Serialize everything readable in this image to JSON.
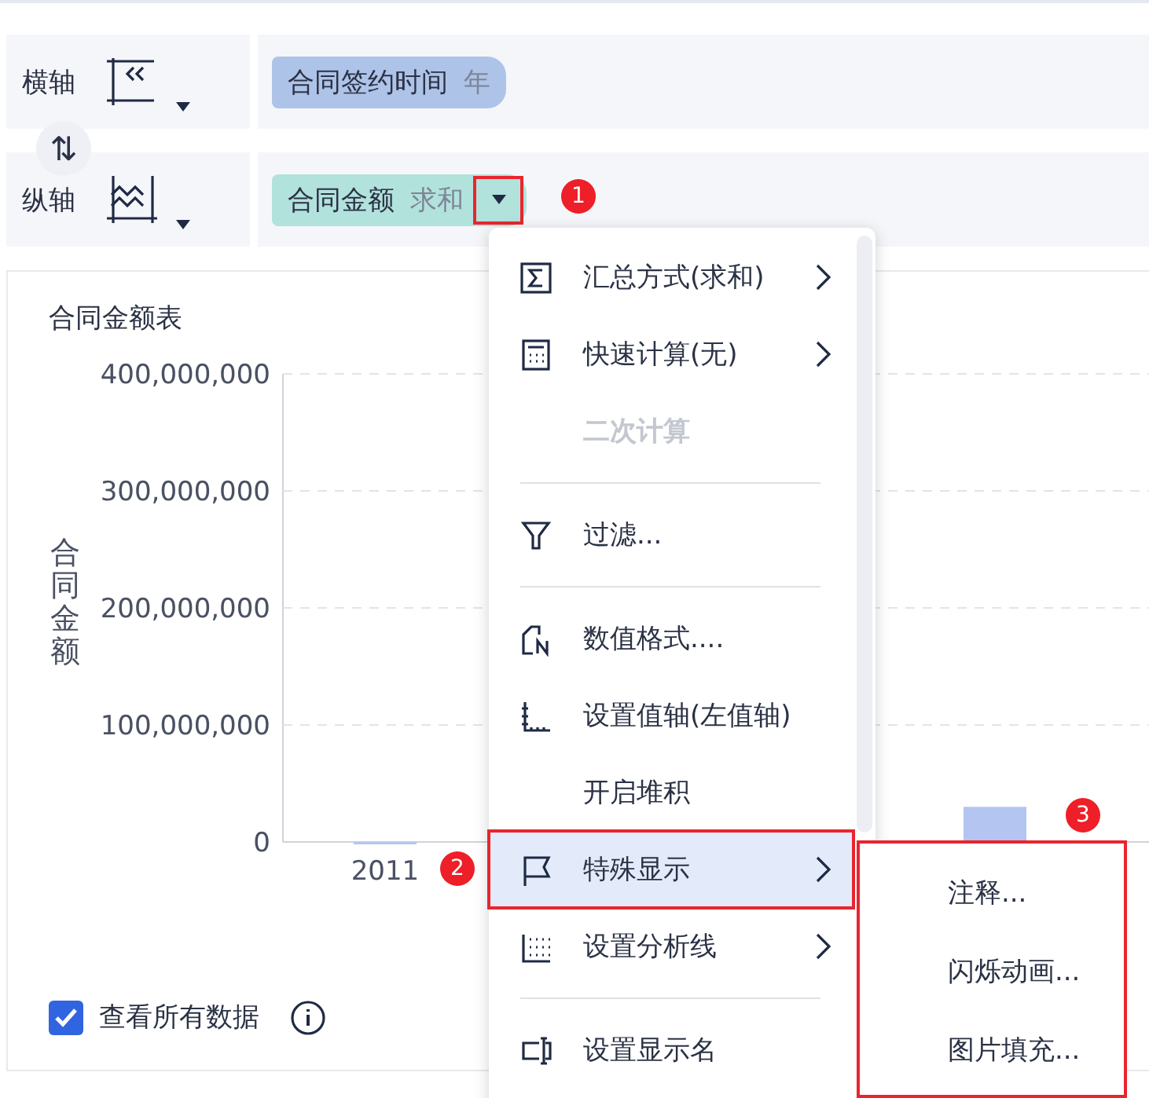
{
  "axes": [
    {
      "label": "横轴",
      "field": {
        "name": "合同签约时间",
        "aggregation": "年",
        "color": "#aec3e8",
        "dropdown_highlighted": false
      }
    },
    {
      "label": "纵轴",
      "field": {
        "name": "合同金额",
        "aggregation": "求和",
        "color": "#b2e2dc",
        "dropdown_highlighted": true
      }
    }
  ],
  "swap": {
    "symbol": "⇅"
  },
  "chart": {
    "title": "合同金额表",
    "y_title": "合同金额",
    "chart_data": {
      "type": "bar",
      "grid": true,
      "categories": [
        "2011",
        null
      ],
      "series": [
        {
          "color": "#b3c5f0",
          "values": [
            0,
            30000000
          ]
        }
      ],
      "ylim": [
        0,
        400000000
      ],
      "yticks": [
        {
          "value": 0,
          "label": "0"
        },
        {
          "value": 100000000,
          "label": "100,000,000"
        },
        {
          "value": 200000000,
          "label": "200,000,000"
        },
        {
          "value": 300000000,
          "label": "300,000,000"
        },
        {
          "value": 400000000,
          "label": "400,000,000"
        }
      ]
    }
  },
  "show_all": {
    "label": "查看所有数据",
    "checked": true
  },
  "menu": {
    "items": [
      {
        "kind": "sigma",
        "label": "汇总方式(求和)",
        "submenu": true,
        "disabled": false,
        "selected": false
      },
      {
        "kind": "calculator",
        "label": "快速计算(无)",
        "submenu": true,
        "disabled": false,
        "selected": false
      },
      {
        "kind": "plain",
        "label": "二次计算",
        "submenu": false,
        "disabled": true,
        "selected": false
      },
      {
        "kind": "divider"
      },
      {
        "kind": "filter",
        "label": "过滤...",
        "submenu": false,
        "disabled": false,
        "selected": false
      },
      {
        "kind": "divider"
      },
      {
        "kind": "format",
        "label": "数值格式....",
        "submenu": false,
        "disabled": false,
        "selected": false
      },
      {
        "kind": "axis",
        "label": "设置值轴(左值轴)",
        "submenu": false,
        "disabled": false,
        "selected": false
      },
      {
        "kind": "plain",
        "label": "开启堆积",
        "submenu": false,
        "disabled": false,
        "selected": false
      },
      {
        "kind": "flag",
        "label": "特殊显示",
        "submenu": true,
        "disabled": false,
        "selected": true
      },
      {
        "kind": "lines",
        "label": "设置分析线",
        "submenu": true,
        "disabled": false,
        "selected": false
      },
      {
        "kind": "divider"
      },
      {
        "kind": "rename",
        "label": "设置显示名",
        "submenu": false,
        "disabled": false,
        "selected": false
      }
    ]
  },
  "submenu": {
    "items": [
      {
        "label": "注释..."
      },
      {
        "label": "闪烁动画..."
      },
      {
        "label": "图片填充..."
      }
    ]
  },
  "callouts": [
    {
      "number": "1"
    },
    {
      "number": "2"
    },
    {
      "number": "3"
    }
  ]
}
